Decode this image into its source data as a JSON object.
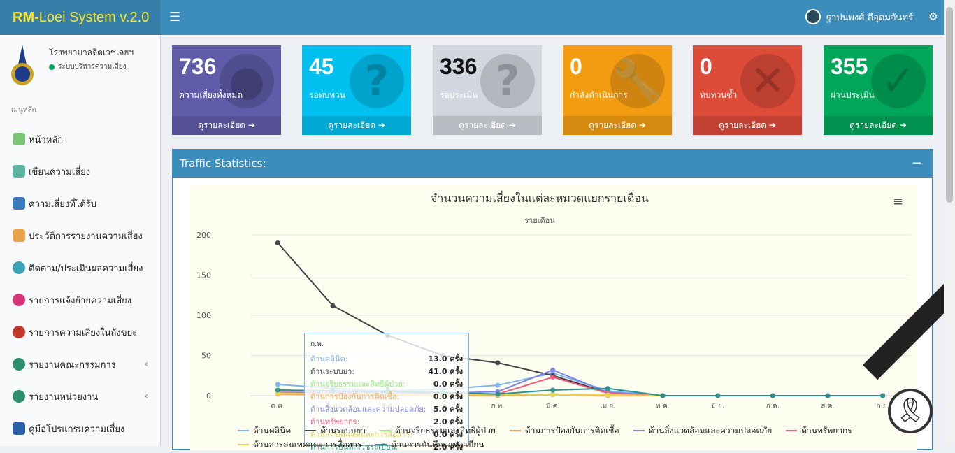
{
  "header": {
    "brand_a": "RM-",
    "brand_b": "Loei System v.2.0",
    "user_name": "ฐาปนพงศ์ ดีอุดมจันทร์"
  },
  "sidebar": {
    "hospital": "โรงพยาบาลจิตเวชเลยฯ",
    "subtitle": "ระบบบริหารความเสี่ยง",
    "menu_header": "เมนูหลัก",
    "items": [
      {
        "label": "หน้าหลัก"
      },
      {
        "label": "เขียนความเสี่ยง"
      },
      {
        "label": "ความเสี่ยงที่ได้รับ"
      },
      {
        "label": "ประวัติการรายงานความเสี่ยง"
      },
      {
        "label": "ติดตาม/ประเมินผลความเสี่ยง"
      },
      {
        "label": "รายการแจ้งย้ายความเสี่ยง"
      },
      {
        "label": "รายการความเสี่ยงในถังขยะ"
      },
      {
        "label": "รายงานคณะกรรมการ"
      },
      {
        "label": "รายงานหน่วยงาน"
      },
      {
        "label": "คู่มือโปรแกรมความเสี่ยง"
      }
    ]
  },
  "boxes": [
    {
      "num": "736",
      "label": "ความเสี่ยงทั้งหมด",
      "foot": "ดูรายละเอียด ➔",
      "color": "#605ca8"
    },
    {
      "num": "45",
      "label": "รอทบทวน",
      "foot": "ดูรายละเอียด ➔",
      "color": "#00c0ef"
    },
    {
      "num": "336",
      "label": "รอประเมิน",
      "foot": "ดูรายละเอียด ➔",
      "color": "#d2d6de"
    },
    {
      "num": "0",
      "label": "กำลังดำเนินการ",
      "foot": "ดูรายละเอียด ➔",
      "color": "#f39c12"
    },
    {
      "num": "0",
      "label": "ทบทวนซ้ำ",
      "foot": "ดูรายละเอียด ➔",
      "color": "#dd4b39"
    },
    {
      "num": "355",
      "label": "ผ่านประเมิน",
      "foot": "ดูรายละเอียด ➔",
      "color": "#00a65a"
    }
  ],
  "panel": {
    "title": "Traffic Statistics:"
  },
  "chart_data": {
    "type": "line",
    "title": "จำนวนความเสี่ยงในแต่ละหมวดแยกรายเดือน",
    "subtitle": "รายเดือน",
    "categories": [
      "ต.ค.",
      "พ.ย.",
      "ธ.ค.",
      "ม.ค.",
      "ก.พ.",
      "มี.ค.",
      "เม.ย.",
      "พ.ค.",
      "มิ.ย.",
      "ก.ค.",
      "ส.ค.",
      "ก.ย."
    ],
    "ylim": [
      0,
      200
    ],
    "yticks": [
      0,
      50,
      100,
      150,
      200
    ],
    "series": [
      {
        "name": "ด้านคลินิค",
        "color": "#7cb5ec",
        "values": [
          14,
          9,
          6,
          8,
          13,
          28,
          6,
          0,
          0,
          0,
          0,
          0
        ]
      },
      {
        "name": "ด้านระบบยา",
        "color": "#434348",
        "values": [
          190,
          112,
          75,
          50,
          41,
          25,
          4,
          0,
          0,
          0,
          0,
          0
        ]
      },
      {
        "name": "ด้านจริยธรรมและสิทธิผู้ป่วย",
        "color": "#90ed7d",
        "values": [
          3,
          2,
          1,
          1,
          0,
          2,
          1,
          0,
          0,
          0,
          0,
          0
        ]
      },
      {
        "name": "ด้านการป้องกันการติดเชื้อ",
        "color": "#f7a35c",
        "values": [
          2,
          1,
          1,
          0,
          0,
          1,
          0,
          0,
          0,
          0,
          0,
          0
        ]
      },
      {
        "name": "ด้านสิ่งแวดล้อมและความปลอดภัย",
        "color": "#8085e9",
        "values": [
          6,
          5,
          4,
          3,
          5,
          32,
          4,
          0,
          0,
          0,
          0,
          0
        ]
      },
      {
        "name": "ด้านทรัพยากร",
        "color": "#f15c80",
        "values": [
          4,
          3,
          2,
          2,
          2,
          23,
          3,
          0,
          0,
          0,
          0,
          0
        ]
      },
      {
        "name": "ด้านสารสนเทศและการสื่อสาร",
        "color": "#e4d354",
        "values": [
          3,
          2,
          2,
          1,
          2,
          1,
          1,
          0,
          0,
          0,
          0,
          0
        ]
      },
      {
        "name": "ด้านการบันทึกเวชระเบียน",
        "color": "#2b908f",
        "values": [
          7,
          6,
          5,
          4,
          2,
          7,
          9,
          0,
          0,
          0,
          0,
          0
        ]
      }
    ]
  },
  "tooltip": {
    "month": "ก.พ.",
    "rows": [
      {
        "name": "ด้านคลินิค:",
        "value": "13.0 ครั้ง",
        "color": "#7cb5ec"
      },
      {
        "name": "ด้านระบบยา:",
        "value": "41.0 ครั้ง",
        "color": "#434348"
      },
      {
        "name": "ด้านจริยธรรมและสิทธิผู้ป่วย:",
        "value": "0.0 ครั้ง",
        "color": "#90ed7d"
      },
      {
        "name": "ด้านการป้องกันการติดเชื้อ:",
        "value": "0.0 ครั้ง",
        "color": "#f7a35c"
      },
      {
        "name": "ด้านสิ่งแวดล้อมและความปลอดภัย:",
        "value": "5.0 ครั้ง",
        "color": "#8085e9"
      },
      {
        "name": "ด้านทรัพยากร:",
        "value": "2.0 ครั้ง",
        "color": "#f15c80"
      },
      {
        "name": "ด้านสารสนเทศและการสื่อสาร:",
        "value": "0.0 ครั้ง",
        "color": "#e4d354"
      },
      {
        "name": "ด้านการบันทึกเวชระเบียน:",
        "value": "2.0 ครั้ง",
        "color": "#2b908f"
      }
    ]
  }
}
